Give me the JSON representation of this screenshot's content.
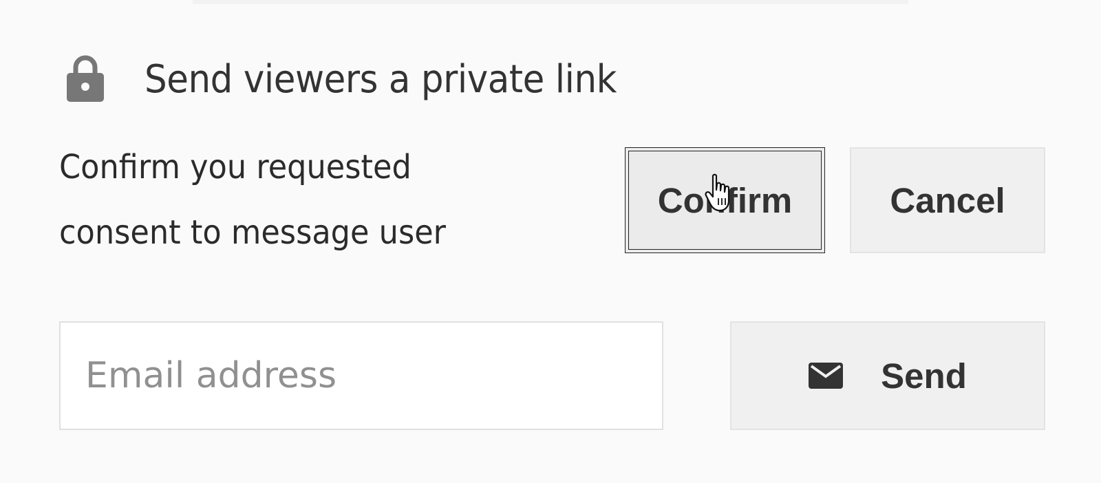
{
  "panel": {
    "heading": "Send viewers a private link",
    "consent_line_1": "Confirm you requested",
    "consent_line_2": "consent to message user"
  },
  "buttons": {
    "confirm_label": "Confirm",
    "cancel_label": "Cancel",
    "send_label": "Send"
  },
  "email": {
    "value": "",
    "placeholder": "Email address"
  },
  "icons": {
    "lock": "lock-icon",
    "mail": "mail-icon",
    "cursor": "hand-pointer-cursor-icon"
  },
  "colors": {
    "background": "#fafafa",
    "button_bg": "#f0f0f0",
    "icon_gray": "#777777",
    "text_dark": "#333333",
    "placeholder": "#909090"
  }
}
